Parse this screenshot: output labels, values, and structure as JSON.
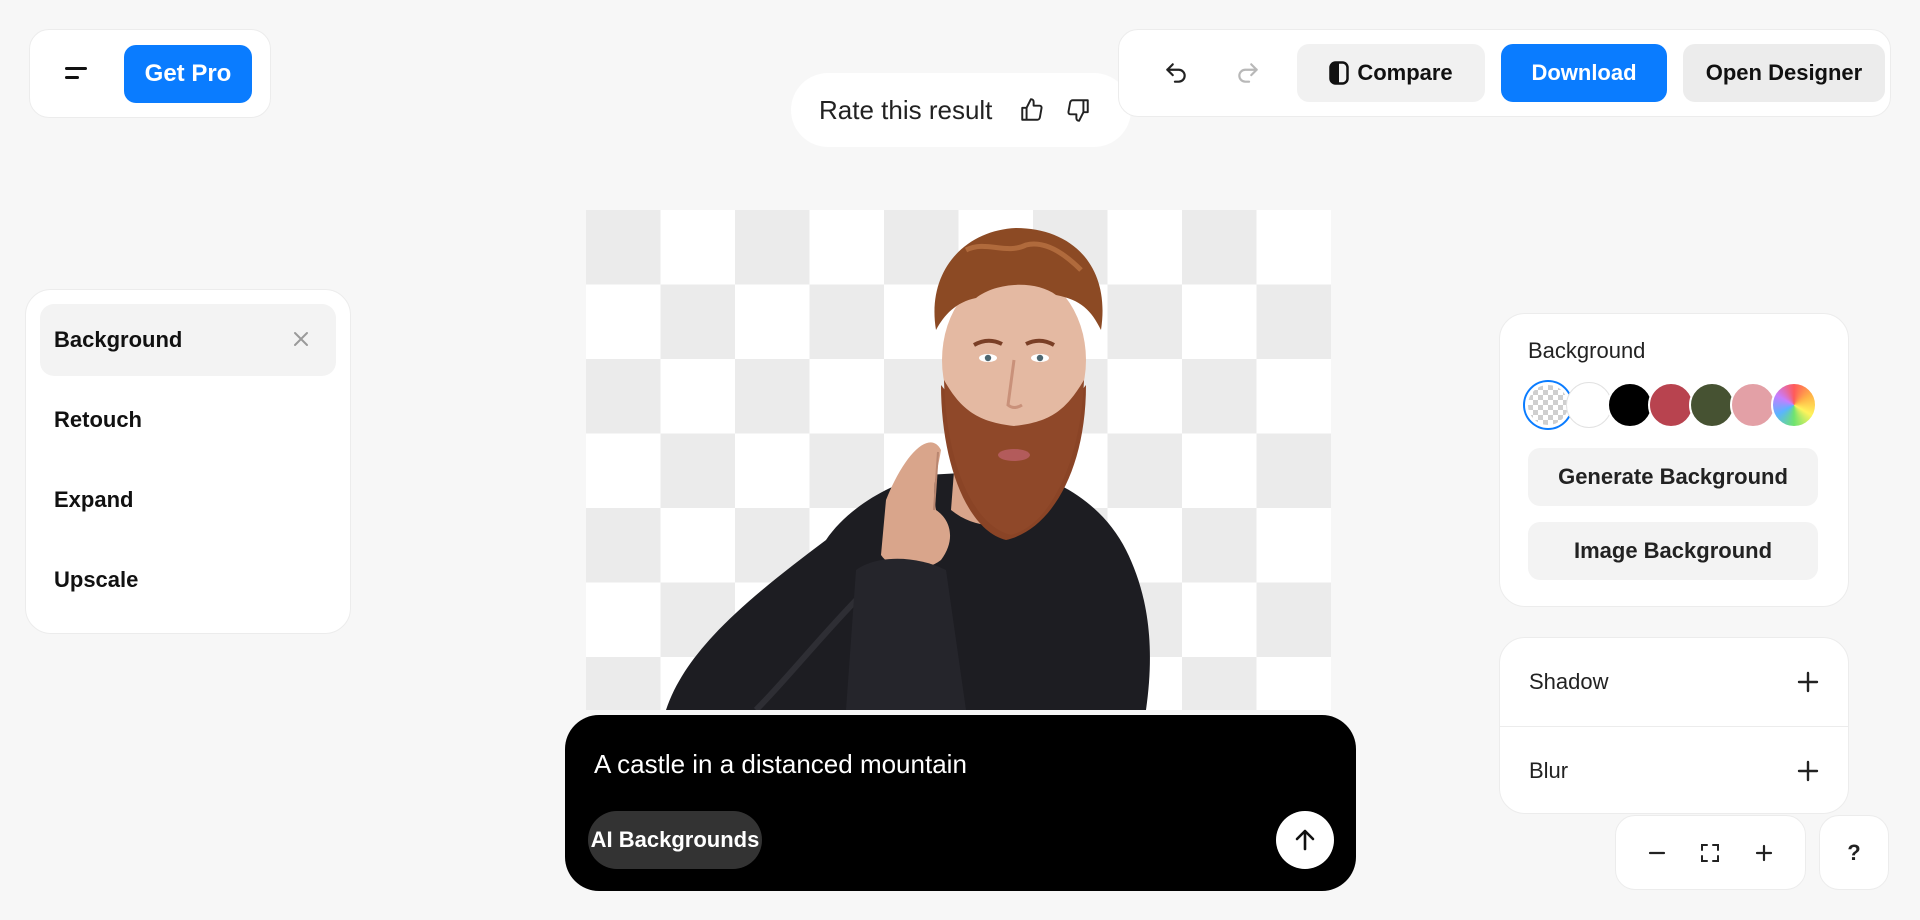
{
  "header": {
    "get_pro_label": "Get Pro",
    "rate_label": "Rate this result",
    "compare_label": "Compare",
    "download_label": "Download",
    "open_designer_label": "Open Designer"
  },
  "tools": {
    "items": [
      {
        "label": "Background",
        "active": true
      },
      {
        "label": "Retouch"
      },
      {
        "label": "Expand"
      },
      {
        "label": "Upscale"
      }
    ]
  },
  "prompt": {
    "text": "A castle in a distanced mountain",
    "chip_label": "AI Backgrounds"
  },
  "background_panel": {
    "title": "Background",
    "swatches": [
      {
        "name": "transparent",
        "selected": true
      },
      {
        "name": "white",
        "color": "#ffffff"
      },
      {
        "name": "black",
        "color": "#000000"
      },
      {
        "name": "red",
        "color": "#b8434f"
      },
      {
        "name": "olive",
        "color": "#465232"
      },
      {
        "name": "pink",
        "color": "#e3a0a6"
      },
      {
        "name": "rainbow"
      }
    ],
    "generate_label": "Generate Background",
    "image_label": "Image Background"
  },
  "effects": {
    "shadow_label": "Shadow",
    "blur_label": "Blur"
  },
  "zoom": {
    "minus": "−",
    "plus": "+"
  },
  "help_label": "?",
  "colors": {
    "accent": "#0a7cff",
    "background": "#f7f7f7"
  }
}
